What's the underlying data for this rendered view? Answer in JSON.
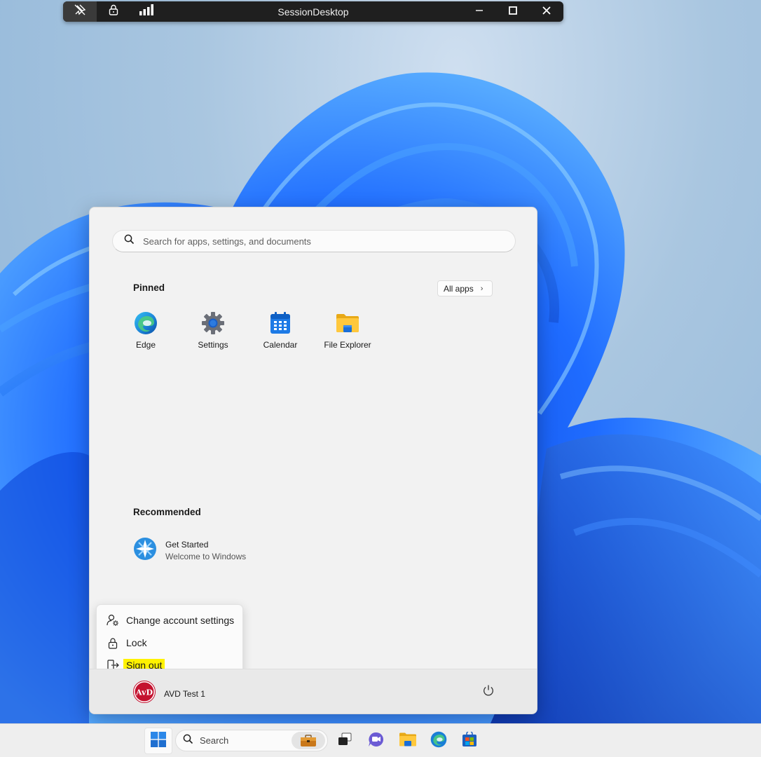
{
  "connection_bar": {
    "title": "SessionDesktop",
    "pin_icon": "unpin-icon",
    "lock_icon": "lock-icon",
    "signal_icon": "signal-bars-icon"
  },
  "start_menu": {
    "search": {
      "placeholder": "Search for apps, settings, and documents"
    },
    "pinned": {
      "title": "Pinned",
      "all_apps_label": "All apps",
      "apps": [
        {
          "label": "Edge",
          "icon": "edge-icon"
        },
        {
          "label": "Settings",
          "icon": "settings-gear-icon"
        },
        {
          "label": "Calendar",
          "icon": "calendar-icon"
        },
        {
          "label": "File Explorer",
          "icon": "folder-icon"
        }
      ]
    },
    "recommended": {
      "title": "Recommended",
      "items": [
        {
          "title": "Get Started",
          "subtitle": "Welcome to Windows",
          "icon": "get-started-icon"
        }
      ]
    },
    "account_menu": {
      "items": [
        {
          "label": "Change account settings",
          "icon": "account-settings-icon"
        },
        {
          "label": "Lock",
          "icon": "lock-icon"
        },
        {
          "label": "Sign out",
          "icon": "sign-out-icon",
          "highlight": "#fff200"
        }
      ]
    },
    "user": {
      "name": "AVD Test 1",
      "avatar_text": "AvD"
    }
  },
  "taskbar": {
    "search_label": "Search",
    "items": [
      "start-icon",
      "work-icon",
      "task-view-icon",
      "teams-chat-icon",
      "file-explorer-icon",
      "edge-icon",
      "store-icon"
    ]
  },
  "colors": {
    "accent": "#0067c0",
    "highlight": "#fff200"
  }
}
